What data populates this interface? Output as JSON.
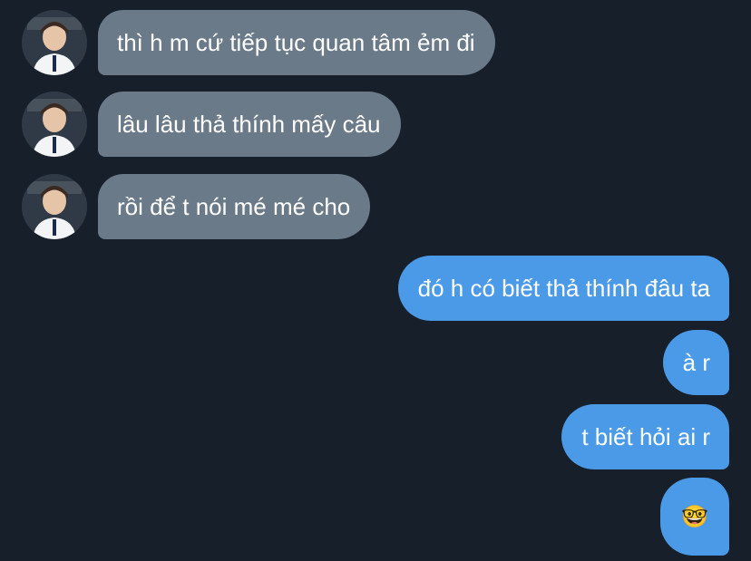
{
  "colors": {
    "background": "#17202a",
    "incoming_bubble": "#6b7a89",
    "outgoing_bubble": "#4a9ae7",
    "text": "#ffffff"
  },
  "messages": [
    {
      "direction": "incoming",
      "text": "thì h m cứ tiếp tục quan tâm ẻm đi"
    },
    {
      "direction": "incoming",
      "text": "lâu lâu thả thính mấy câu"
    },
    {
      "direction": "incoming",
      "text": "rồi để t nói mé mé cho"
    },
    {
      "direction": "outgoing",
      "text": "đó h có biết thả thính đâu ta"
    },
    {
      "direction": "outgoing",
      "text": "à r"
    },
    {
      "direction": "outgoing",
      "text": "t biết hỏi ai r"
    },
    {
      "direction": "outgoing",
      "text": "🤓",
      "icon": "nerd-face-emoji"
    }
  ]
}
